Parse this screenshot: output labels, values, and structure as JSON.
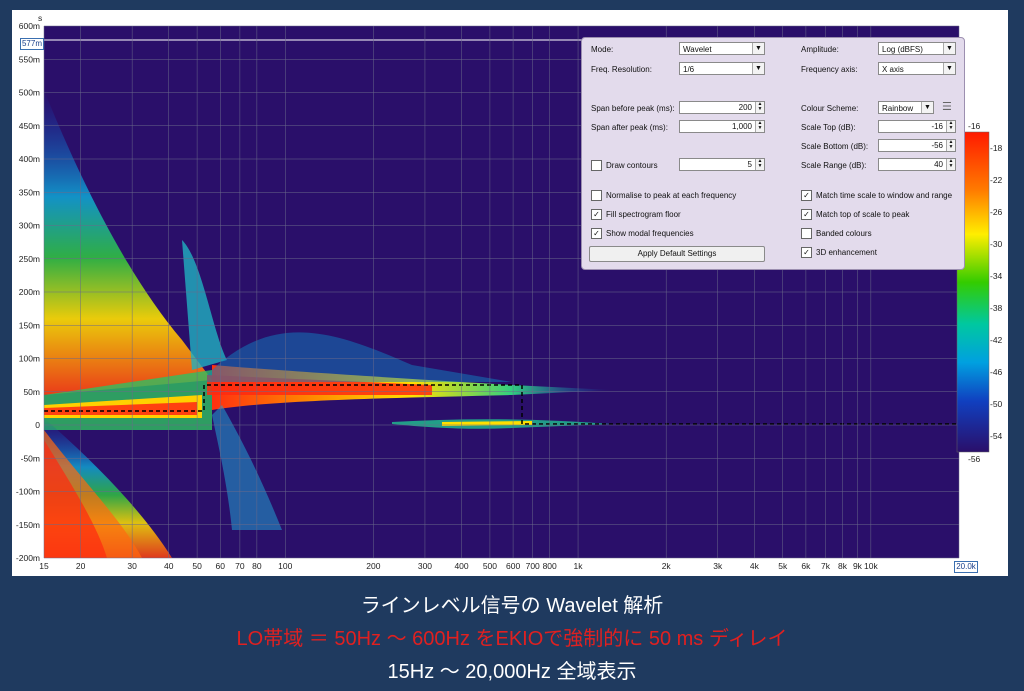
{
  "plot": {
    "y_unit": "s",
    "y_cursor": "577m",
    "x_cursor": "20.0k",
    "y_ticks": [
      "600m",
      "550m",
      "500m",
      "450m",
      "400m",
      "350m",
      "300m",
      "250m",
      "200m",
      "150m",
      "100m",
      "50m",
      "0",
      "-50m",
      "-100m",
      "-150m",
      "-200m"
    ],
    "x_ticks": [
      "15",
      "20",
      "30",
      "40",
      "50",
      "60",
      "70",
      "80",
      "100",
      "200",
      "300",
      "400",
      "500",
      "600",
      "700",
      "800",
      "1k",
      "2k",
      "3k",
      "4k",
      "5k",
      "6k",
      "7k",
      "8k",
      "9k",
      "10k",
      "2"
    ],
    "background_color": "#2a0f6a"
  },
  "colorbar": {
    "top_label": "-16",
    "bottom_label": "-56",
    "ticks": [
      "-18",
      "-22",
      "-26",
      "-30",
      "-34",
      "-38",
      "-42",
      "-46",
      "-50",
      "-54"
    ]
  },
  "settings": {
    "mode_label": "Mode:",
    "mode_value": "Wavelet",
    "freq_res_label": "Freq. Resolution:",
    "freq_res_value": "1/6",
    "amplitude_label": "Amplitude:",
    "amplitude_value": "Log (dBFS)",
    "freq_axis_label": "Frequency axis:",
    "freq_axis_value": "X axis",
    "span_before_label": "Span before peak (ms):",
    "span_before_value": "200",
    "span_after_label": "Span after peak (ms):",
    "span_after_value": "1,000",
    "colour_scheme_label": "Colour Scheme:",
    "colour_scheme_value": "Rainbow",
    "scale_top_label": "Scale Top (dB):",
    "scale_top_value": "-16",
    "scale_bottom_label": "Scale Bottom (dB):",
    "scale_bottom_value": "-56",
    "scale_range_label": "Scale Range (dB):",
    "scale_range_value": "40",
    "draw_contours_label": "Draw contours",
    "draw_contours_value": "5",
    "normalise_label": "Normalise to peak at each frequency",
    "fill_floor_label": "Fill spectrogram floor",
    "modal_label": "Show modal frequencies",
    "apply_default_label": "Apply Default Settings",
    "match_time_label": "Match time scale to window and range",
    "match_top_label": "Match top of scale to peak",
    "banded_label": "Banded colours",
    "enhance_label": "3D enhancement",
    "checkbox_states": {
      "draw_contours": false,
      "normalise": false,
      "fill_floor": true,
      "modal": true,
      "match_time": true,
      "match_top": true,
      "banded": false,
      "enhance": true
    }
  },
  "caption": {
    "line1": "ラインレベル信号の Wavelet 解析",
    "line2": "LO帯域 ＝ 50Hz ～ 600Hz をEKIOで強制的に 50 ms ディレイ",
    "line3": "15Hz ～ 20,000Hz 全域表示",
    "line1_color": "#ffffff",
    "line2_color": "#e02020",
    "line3_color": "#ffffff"
  }
}
